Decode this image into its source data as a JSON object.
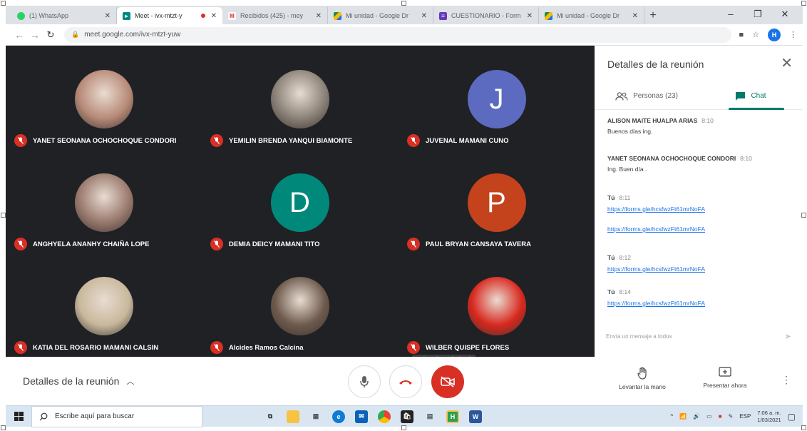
{
  "browser": {
    "tabs": [
      {
        "title": "(1) WhatsApp",
        "favicon": "whatsapp-icon",
        "color": "#25d366"
      },
      {
        "title": "Meet - ivx-mtzt-y",
        "favicon": "meet-icon",
        "color": "#00897b",
        "recording": true,
        "active": true
      },
      {
        "title": "Recibidos (425) - mey",
        "favicon": "gmail-icon",
        "color": "#d93025"
      },
      {
        "title": "Mi unidad - Google Dr",
        "favicon": "drive-icon",
        "color": "#1e8e3e"
      },
      {
        "title": "CUESTIONARIO - Form",
        "favicon": "forms-icon",
        "color": "#673ab7"
      },
      {
        "title": "Mi unidad - Google Dr",
        "favicon": "drive-icon",
        "color": "#1e8e3e"
      }
    ],
    "url": "meet.google.com/ivx-mtzt-yuw",
    "profile_initial": "H"
  },
  "participants": [
    {
      "name": "YANET SEONANA OCHOCHOQUE CONDORI",
      "avatar": "photo",
      "color": "#b88a78"
    },
    {
      "name": "YEMILIN BRENDA YANQUI BIAMONTE",
      "avatar": "photo",
      "color": "#8a8278"
    },
    {
      "name": "JUVENAL MAMANI CUNO",
      "avatar": "letter",
      "letter": "J",
      "color": "#5c6bc0"
    },
    {
      "name": "ANGHYELA ANANHY CHAIÑA LOPE",
      "avatar": "photo",
      "color": "#9a7a6e"
    },
    {
      "name": "DEMIA DEICY MAMANI TITO",
      "avatar": "letter",
      "letter": "D",
      "color": "#00897b"
    },
    {
      "name": "PAUL BRYAN CANSAYA TAVERA",
      "avatar": "letter",
      "letter": "P",
      "color": "#c4421c"
    },
    {
      "name": "KATIA DEL ROSARIO MAMANI CALSIN",
      "avatar": "photo",
      "color": "#c8b89c"
    },
    {
      "name": "Alcides Ramos Calcina",
      "avatar": "photo",
      "color": "#6d5a4c"
    },
    {
      "name": "WILBER QUISPE FLORES",
      "avatar": "photo",
      "color": "#d8281e"
    }
  ],
  "tooltip": "Activar cámara (Ctrl + E)",
  "bottom": {
    "details_label": "Detalles de la reunión",
    "raise_hand": "Levantar la mano",
    "present_now": "Presentar ahora"
  },
  "panel": {
    "title": "Detalles de la reunión",
    "tab_people": "Personas (23)",
    "tab_chat": "Chat",
    "compose_placeholder": "Envía un mensaje a todos",
    "messages": [
      {
        "sender": "ALISON MAITE HUALPA ARIAS",
        "time": "8:10",
        "text": "Buenos días ing."
      },
      {
        "sender": "YANET SEONANA OCHOCHOQUE CONDORI",
        "time": "8:10",
        "text": "Ing. Buen día ."
      },
      {
        "sender": "Tú",
        "time": "8:11",
        "links": [
          "https://forms.gle/hcsfwzFt61mrNoFA",
          "https://forms.gle/hcsfwzFt61mrNoFA"
        ]
      },
      {
        "sender": "Tú",
        "time": "8:12",
        "links": [
          "https://forms.gle/hcsfwzFt61mrNoFA"
        ]
      },
      {
        "sender": "Tú",
        "time": "8:14",
        "links": [
          "https://forms.gle/hcsfwzFt61mrNoFA"
        ]
      }
    ]
  },
  "taskbar": {
    "search_placeholder": "Escribe aquí para buscar",
    "lang": "ESP",
    "time": "7:06 a. m.",
    "date": "1/03/2021"
  }
}
